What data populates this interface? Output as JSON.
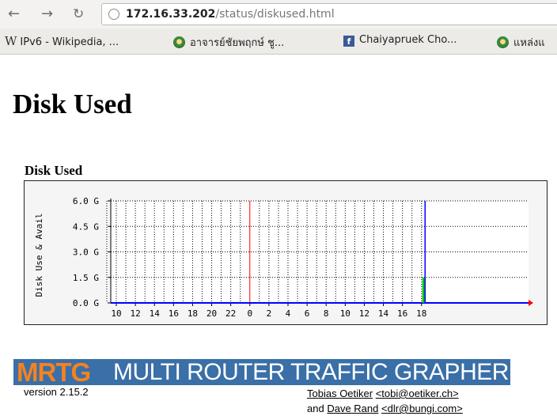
{
  "browser": {
    "url_host": "172.16.33.202",
    "url_path": "/status/diskused.html",
    "bookmarks": [
      {
        "icon": "wikipedia-w-icon",
        "label": "IPv6 - Wikipedia, ..."
      },
      {
        "icon": "seal-icon",
        "label": "อาจารย์ชัยพฤกษ์ ชู..."
      },
      {
        "icon": "facebook-icon",
        "label": "Chaiyapruek Cho..."
      },
      {
        "icon": "seal-icon",
        "label": "แหล่งแ"
      }
    ]
  },
  "page": {
    "title": "Disk Used",
    "graph_title": "Disk Used"
  },
  "chart_data": {
    "type": "area",
    "ylabel": "Disk Use & Avail",
    "y_ticks": [
      "0.0 G",
      "1.5 G",
      "3.0 G",
      "4.5 G",
      "6.0 G"
    ],
    "ylim_gb": [
      0,
      6
    ],
    "x_ticks": [
      "10",
      "12",
      "14",
      "16",
      "18",
      "20",
      "22",
      "0",
      "2",
      "4",
      "6",
      "8",
      "10",
      "12",
      "14",
      "16",
      "18"
    ],
    "grid": true,
    "day_boundary_tick": "0",
    "series": [
      {
        "color": "#00cc00",
        "peak_value_gb": 1.5,
        "at_tick": "18"
      },
      {
        "color": "#0000ff",
        "peak_value_gb": 6.0,
        "at_tick": "18"
      }
    ],
    "colors": {
      "grid": "#000000",
      "day_line": "#ff0000",
      "axis_arrow": "#ff0000",
      "baseline": "#0000ff"
    }
  },
  "footer": {
    "logo": "MRTG",
    "name": "MULTI ROUTER TRAFFIC GRAPHER",
    "version": "version 2.15.2",
    "author1": "Tobias Oetiker",
    "email1": "<tobi@oetiker.ch>",
    "and": "and",
    "author2": "Dave Rand",
    "email2": "<dlr@bungi.com>"
  }
}
